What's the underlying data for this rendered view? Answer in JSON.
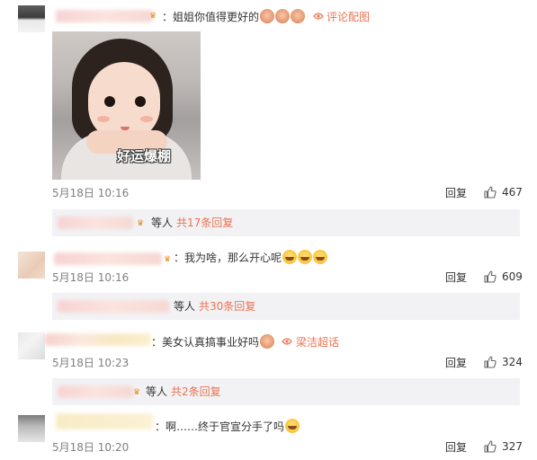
{
  "comments": [
    {
      "text": "：姐姐你值得更好的",
      "emoji": [
        "pig-emoji",
        "pig-emoji",
        "pig-emoji"
      ],
      "source_link": "评论配图",
      "image_caption": "好运爆棚",
      "time": "5月18日 10:16",
      "reply_label": "回复",
      "likes": "467",
      "replies": {
        "who": "等人",
        "count": "共17条回复"
      }
    },
    {
      "text": "：我为啥，那么开心呢",
      "emoji": [
        "laugh-cry-emoji",
        "laugh-cry-emoji",
        "laugh-cry-emoji"
      ],
      "time": "5月18日 10:16",
      "reply_label": "回复",
      "likes": "609",
      "replies": {
        "who": "等人",
        "count": "共30条回复"
      }
    },
    {
      "text": "：美女认真搞事业好吗",
      "emoji": [
        "pig-emoji"
      ],
      "source_link": "梁洁超话",
      "time": "5月18日 10:23",
      "reply_label": "回复",
      "likes": "324",
      "replies": {
        "who": "等人",
        "count": "共2条回复"
      }
    },
    {
      "text": "：啊……终于官宣分手了吗",
      "emoji": [
        "laugh-cry-emoji"
      ],
      "time": "5月18日 10:20",
      "reply_label": "回复",
      "likes": "327"
    }
  ],
  "colors": {
    "link": "#eb7350",
    "meta": "#808080",
    "reply_bar": "#f2f2f5"
  },
  "icons": {
    "like": "thumbs-up-icon",
    "source": "eye-link-icon",
    "vip": "vip-badge-icon"
  }
}
